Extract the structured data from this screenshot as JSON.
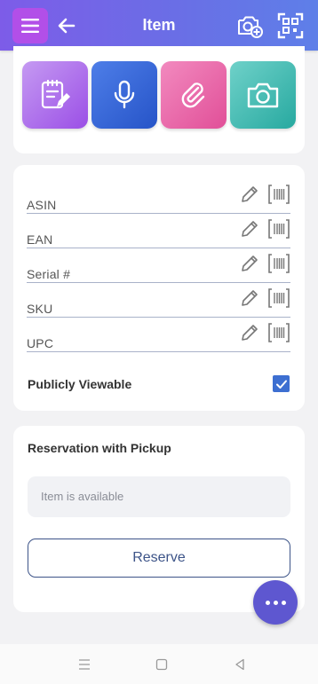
{
  "header": {
    "title": "Item"
  },
  "identifiers": [
    {
      "label": "ASIN"
    },
    {
      "label": "EAN"
    },
    {
      "label": "Serial #"
    },
    {
      "label": "SKU"
    },
    {
      "label": "UPC"
    }
  ],
  "publicly_viewable": {
    "label": "Publicly Viewable",
    "checked": true
  },
  "reservation": {
    "heading": "Reservation with Pickup",
    "status_placeholder": "Item is available",
    "button_label": "Reserve"
  },
  "colors": {
    "appbar_gradient": [
      "#7d5ce8",
      "#5e7fe8"
    ],
    "menu_button": "#b24fe8",
    "notes_tile": "#9b4fe6",
    "voice_tile": "#2654c8",
    "attach_tile": "#e14f98",
    "camera_tile": "#27a9a0",
    "fab": "#5e57d0",
    "checkbox": "#3d6fd1"
  },
  "icons": {
    "header": [
      "menu-icon",
      "back-arrow-icon",
      "add-photo-icon",
      "scan-icon"
    ],
    "tiles": [
      "notes-icon",
      "microphone-icon",
      "paperclip-icon",
      "camera-icon"
    ],
    "fields": [
      "pencil-icon",
      "barcode-icon"
    ],
    "fab": "more-icon",
    "system_nav": [
      "recents-icon",
      "home-icon",
      "back-icon"
    ]
  }
}
